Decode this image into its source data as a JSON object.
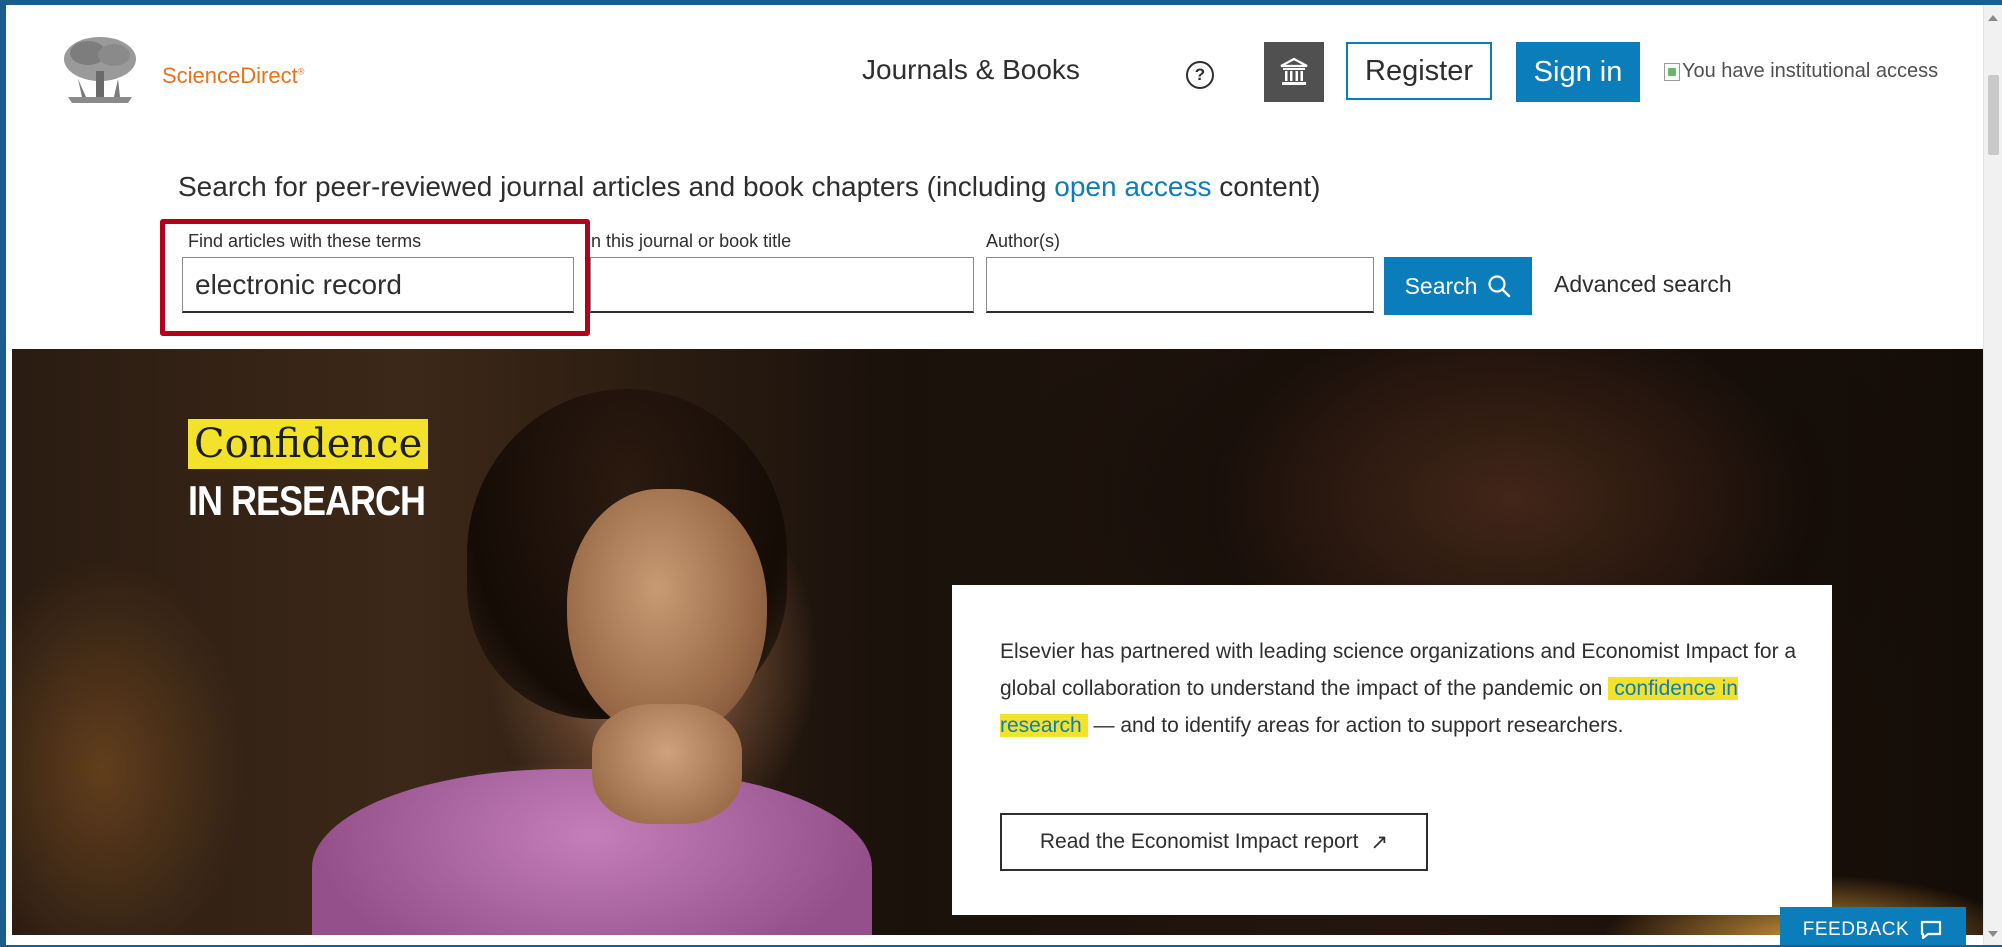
{
  "header": {
    "logo_text": "ScienceDirect",
    "logo_mark": "®",
    "nav_journals": "Journals & Books",
    "help_glyph": "?",
    "register_label": "Register",
    "signin_label": "Sign in",
    "institutional_access_alt": "You have institutional access"
  },
  "search": {
    "heading_prefix": "Search for peer-reviewed journal articles and book chapters (including ",
    "heading_link": "open access",
    "heading_suffix": " content)",
    "terms_label": "Find articles with these terms",
    "terms_value": "electronic record",
    "journal_label": "In this journal or book title",
    "journal_value": "",
    "author_label": "Author(s)",
    "author_value": "",
    "search_button": "Search",
    "advanced_link": "Advanced search"
  },
  "hero": {
    "title_line1": "Confidence",
    "title_line2": "IN RESEARCH",
    "text_before": "Elsevier has partnered with leading science organizations and Economist Impact for a global collaboration to understand the impact of the pandemic on ",
    "text_highlight": "confidence in research",
    "text_after": " — and to identify areas for action to support researchers.",
    "report_button": "Read the Economist Impact report",
    "report_arrow": "↗"
  },
  "feedback": {
    "label": "FEEDBACK"
  },
  "colors": {
    "brand_orange": "#e9711c",
    "brand_blue": "#0c7dbb",
    "highlight_yellow": "#f2e22a",
    "annotation_red": "#b3001b"
  },
  "icons": {
    "search": "search-icon",
    "institution": "institution-icon",
    "help": "help-icon",
    "feedback": "chat-icon",
    "external": "external-link-icon"
  }
}
